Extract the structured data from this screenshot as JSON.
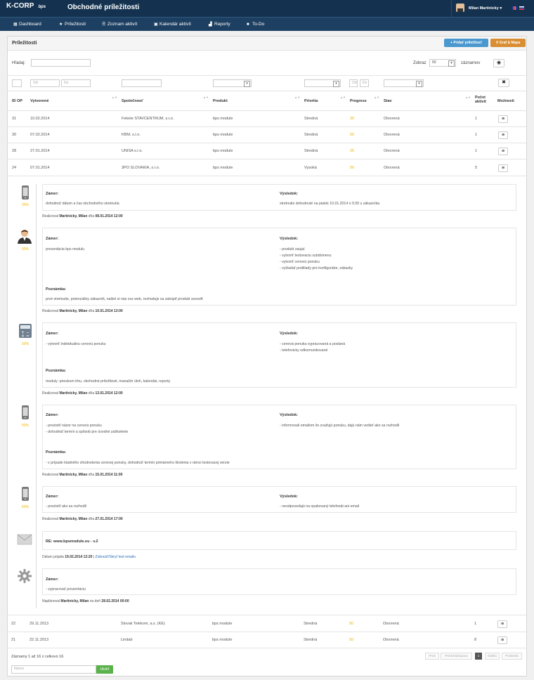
{
  "app": {
    "logo_text": "K-CORP",
    "logo_sub": "bps",
    "title": "Obchodné príležitosti",
    "user_name": "Milan Martinicky"
  },
  "nav": [
    {
      "label": "Dashboard",
      "icon": "dashboard-icon"
    },
    {
      "label": "Príležitosti",
      "icon": "star-icon"
    },
    {
      "label": "Zoznam aktivít",
      "icon": "list-icon"
    },
    {
      "label": "Kalendár aktivít",
      "icon": "calendar-icon"
    },
    {
      "label": "Reporty",
      "icon": "bar-chart-icon"
    },
    {
      "label": "To-Do",
      "icon": "checkbox-icon"
    }
  ],
  "panel": {
    "title": "Príležitosti",
    "add_button": "Pridať príležitosť",
    "chart_button": "Graf & Mapa",
    "search_label": "Hľadaj:",
    "show_label": "Zobraz",
    "show_value": "50",
    "records_label": "záznamov"
  },
  "filters": {
    "from_placeholder": "Od",
    "to_placeholder": "Do"
  },
  "columns": [
    "ID OP",
    "Vytvorené",
    "Spoločnosť",
    "Produkt",
    "Priorita",
    "Progress",
    "Stav",
    "Počet",
    "aktivít",
    "Možnosti"
  ],
  "rows": [
    {
      "id": "31",
      "created": "10.02.2014",
      "company": "Fekete STAVCENTRUM, s.r.o.",
      "product": "bps module",
      "priority": "Stredná",
      "progress": "30",
      "status": "Otvorená",
      "count": "1"
    },
    {
      "id": "30",
      "created": "07.02.2014",
      "company": "KBM, s.r.o.",
      "product": "bps module",
      "priority": "Stredná",
      "progress": "50",
      "status": "Otvorená",
      "count": "1"
    },
    {
      "id": "28",
      "created": "27.01.2014",
      "company": "UNISA s.r.o.",
      "product": "bps module",
      "priority": "Stredná",
      "progress": "25",
      "status": "Otvorená",
      "count": "1"
    },
    {
      "id": "24",
      "created": "07.01.2014",
      "company": "3PO SLOVAKIA, s.r.o.",
      "product": "bps module",
      "priority": "Vysoká",
      "progress": "50",
      "status": "Otvorená",
      "count": "5"
    }
  ],
  "rows_bottom": [
    {
      "id": "22",
      "created": "29.11.2013",
      "company": "Slovak Telekom, a.s. (KE)",
      "product": "bps module",
      "priority": "Stredná",
      "progress": "50",
      "status": "Otvorená",
      "count": "1"
    },
    {
      "id": "21",
      "created": "22.11.2013",
      "company": "Lindab",
      "product": "bps module",
      "priority": "Stredná",
      "progress": "50",
      "status": "Otvorená",
      "count": "8"
    }
  ],
  "timeline": [
    {
      "percent": "25%",
      "zamer_label": "Zámer:",
      "vysledok_label": "Výsledok:",
      "zamer": [
        "dohodnúť dátum a čas obchodného stretnutia"
      ],
      "vysledok": [
        "stretnutie dohodnuté na piatok 10.01.2014 o 9:30 u zákazníka"
      ],
      "footer_prefix": "Realizoval",
      "footer_user": "Martinicky, Milan",
      "footer_mid": "dňa",
      "footer_date": "08.01.2014 12:00"
    },
    {
      "percent": "50%",
      "zamer_label": "Zámer:",
      "vysledok_label": "Výsledok:",
      "zamer": [
        "prezentácia bps modulu"
      ],
      "vysledok": [
        "- produkt zaujal",
        "- vytvoriť testovaciu subdomenu",
        "- vytvoriť cenovú ponuku",
        "- vyžiadať podklady pre konfigurátor, zákazky"
      ],
      "note_label": "Poznámka:",
      "note": "prvé stretnutie, potenciálny zákazník, našiel si nás cez web, rozhoduje sa zakúpiť produkt sunsoft",
      "footer_prefix": "Realizoval",
      "footer_user": "Martinicky, Milan",
      "footer_mid": "dňa",
      "footer_date": "10.01.2014 13:00"
    },
    {
      "percent": "50%",
      "zamer_label": "Zámer:",
      "vysledok_label": "Výsledok:",
      "zamer": [
        "- vytvoriť individuálnu cenovú ponuku"
      ],
      "vysledok": [
        "- cenová ponuka vypracovaná a poslaná",
        "- telefonicky odkomunikované"
      ],
      "note_label": "Poznámka:",
      "note": "moduly: prieskum trhu, obchodné príležitosti, manažér úloh, kalendár, reporty",
      "footer_prefix": "Realizoval",
      "footer_user": "Martinicky, Milan",
      "footer_mid": "dňa",
      "footer_date": "13.01.2014 12:00"
    },
    {
      "percent": "50%",
      "zamer_label": "Zámer:",
      "vysledok_label": "Výsledok:",
      "zamer": [
        "- prezistiť názor na cenovú ponuku",
        "- dohodnúť termín a spôsob pre úvodné zaškolenie"
      ],
      "vysledok": [
        "- informovali emailom že zvažujú ponuku, dajú nám vedieť ako sa rozhodli"
      ],
      "note_label": "Poznámka:",
      "note": "- v prípade kladného zhodnotenia cenovej ponuky, dohodnúť termín primárneho školenia v rámci testovacej verzie",
      "footer_prefix": "Realizoval",
      "footer_user": "Martinicky, Milan",
      "footer_mid": "dňa",
      "footer_date": "15.01.2014 11:00"
    },
    {
      "percent": "50%",
      "zamer_label": "Zámer:",
      "vysledok_label": "Výsledok:",
      "zamer": [
        "- prezistiť ako sa rozhodli"
      ],
      "vysledok": [
        "- neodpovedajú na opakovaný telefonát ani email"
      ],
      "footer_prefix": "Realizoval",
      "footer_user": "Martinicky, Milan",
      "footer_mid": "dňa",
      "footer_date": "27.01.2014 17:00"
    }
  ],
  "email_item": {
    "subject": "RE: www.bpsmodule.eu - v.2",
    "footer_prefix": "Dátum prijatia",
    "footer_date": "19.02.2014 12:20",
    "footer_link": "Zobraziť/Skryť text emailu"
  },
  "planned_item": {
    "zamer_label": "Zámer:",
    "zamer": "- vypracovať prezentáciu",
    "footer_prefix": "Naplánoval",
    "footer_user": "Martinicky, Milan",
    "footer_mid": "na deň",
    "footer_date": "28.02.2014 00:00"
  },
  "footer": {
    "records_info": "Záznamy 1 až 16 z celkovo 16",
    "pager_first": "Prvá",
    "pager_prev": "Predchádzajúca",
    "pager_page": "1",
    "pager_next": "Ďalšia",
    "pager_last": "Posledná",
    "name_placeholder": "Názov",
    "search_button": "Uložiť"
  }
}
